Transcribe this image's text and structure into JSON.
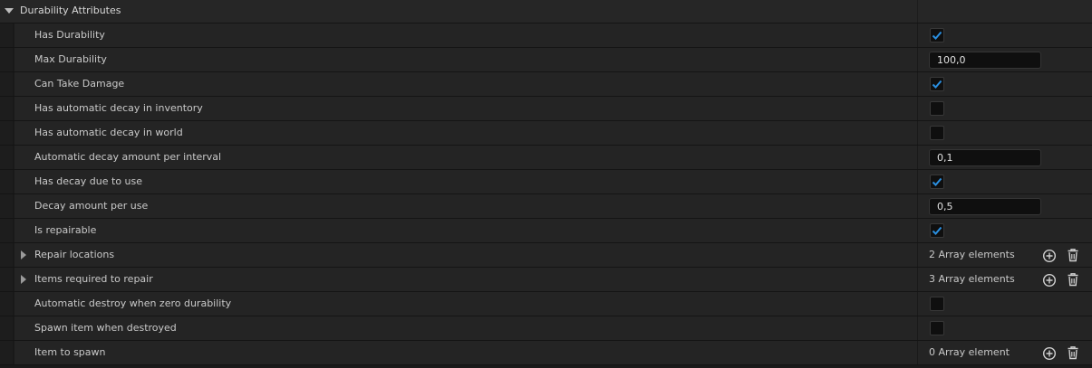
{
  "category": {
    "title": "Durability Attributes",
    "icon": "chevron-down-icon"
  },
  "properties": [
    {
      "label": "Has Durability",
      "type": "checkbox",
      "checked": true
    },
    {
      "label": "Max Durability",
      "type": "number",
      "value": "100,0"
    },
    {
      "label": "Can Take Damage",
      "type": "checkbox",
      "checked": true
    },
    {
      "label": "Has automatic decay in inventory",
      "type": "checkbox",
      "checked": false
    },
    {
      "label": "Has automatic decay in world",
      "type": "checkbox",
      "checked": false
    },
    {
      "label": "Automatic decay amount per interval",
      "type": "number",
      "value": "0,1"
    },
    {
      "label": "Has decay due to use",
      "type": "checkbox",
      "checked": true
    },
    {
      "label": "Decay amount per use",
      "type": "number",
      "value": "0,5"
    },
    {
      "label": "Is repairable",
      "type": "checkbox",
      "checked": true
    },
    {
      "label": "Repair locations",
      "type": "array",
      "value": "2 Array elements",
      "expandable": true
    },
    {
      "label": "Items required to repair",
      "type": "array",
      "value": "3 Array elements",
      "expandable": true
    },
    {
      "label": "Automatic destroy when zero durability",
      "type": "checkbox",
      "checked": false
    },
    {
      "label": "Spawn item when destroyed",
      "type": "checkbox",
      "checked": false
    },
    {
      "label": "Item to spawn",
      "type": "array",
      "value": "0 Array element",
      "expandable": false
    }
  ],
  "colors": {
    "accent": "#2a8fe0",
    "background": "#242424",
    "field": "#0f0f0f"
  },
  "icons": {
    "add": "add-element-icon",
    "delete": "trash-icon",
    "check": "checkmark-icon",
    "expand": "chevron-right-icon"
  }
}
